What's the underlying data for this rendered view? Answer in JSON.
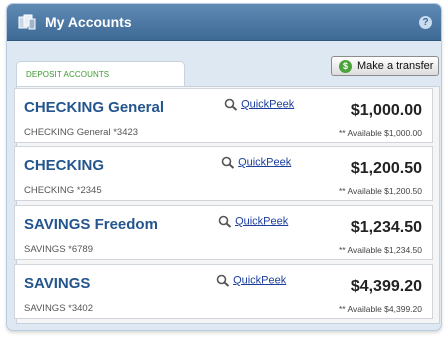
{
  "header": {
    "title": "My Accounts",
    "help_icon": "help-icon"
  },
  "tab": {
    "label": "DEPOSIT ACCOUNTS"
  },
  "transfer_button": {
    "label": "Make a transfer",
    "icon": "dollar-icon"
  },
  "accounts": [
    {
      "name": "CHECKING General",
      "number": "CHECKING General *3423",
      "quickpeek": "QuickPeek",
      "balance": "$1,000.00",
      "available": "** Available $1,000.00"
    },
    {
      "name": "CHECKING",
      "number": "CHECKING *2345",
      "quickpeek": "QuickPeek",
      "balance": "$1,200.50",
      "available": "** Available $1,200.50"
    },
    {
      "name": "SAVINGS Freedom",
      "number": "SAVINGS  *6789",
      "quickpeek": "QuickPeek",
      "balance": "$1,234.50",
      "available": "** Available $1,234.50"
    },
    {
      "name": "SAVINGS",
      "number": "SAVINGS  *3402",
      "quickpeek": "QuickPeek",
      "balance": "$4,399.20",
      "available": "** Available $4,399.20"
    }
  ],
  "colors": {
    "header": "#4a76a2",
    "account_name": "#24558d",
    "link": "#1d3f9e",
    "tab_label": "#3b9a2f"
  }
}
